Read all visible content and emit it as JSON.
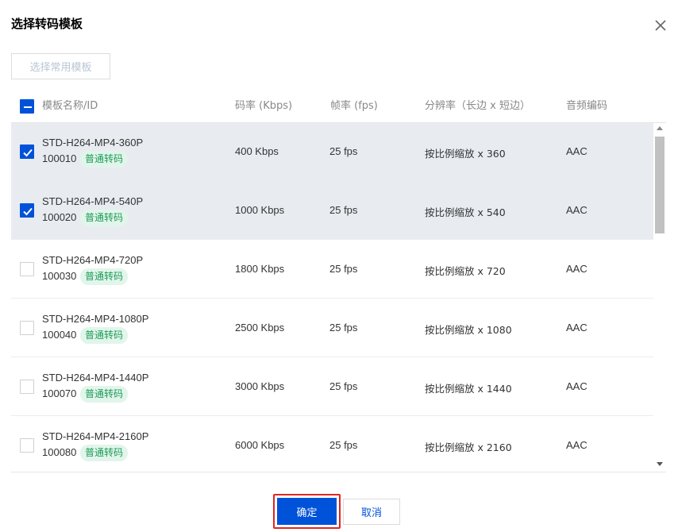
{
  "dialog": {
    "title": "选择转码模板",
    "common_templates_button": "选择常用模板",
    "ok_label": "确定",
    "cancel_label": "取消"
  },
  "table": {
    "select_all_state": "partial",
    "columns": {
      "name": "模板名称/ID",
      "bitrate": "码率 (Kbps)",
      "fps": "帧率 (fps)",
      "resolution": "分辨率（长边 x 短边）",
      "audio": "音频编码"
    },
    "rows": [
      {
        "name": "STD-H264-MP4-360P",
        "id": "100010",
        "tag": "普通转码",
        "bitrate": "400 Kbps",
        "fps": "25 fps",
        "resolution": "按比例缩放 x 360",
        "audio": "AAC",
        "checked": true
      },
      {
        "name": "STD-H264-MP4-540P",
        "id": "100020",
        "tag": "普通转码",
        "bitrate": "1000 Kbps",
        "fps": "25 fps",
        "resolution": "按比例缩放 x 540",
        "audio": "AAC",
        "checked": true
      },
      {
        "name": "STD-H264-MP4-720P",
        "id": "100030",
        "tag": "普通转码",
        "bitrate": "1800 Kbps",
        "fps": "25 fps",
        "resolution": "按比例缩放 x 720",
        "audio": "AAC",
        "checked": false
      },
      {
        "name": "STD-H264-MP4-1080P",
        "id": "100040",
        "tag": "普通转码",
        "bitrate": "2500 Kbps",
        "fps": "25 fps",
        "resolution": "按比例缩放 x 1080",
        "audio": "AAC",
        "checked": false
      },
      {
        "name": "STD-H264-MP4-1440P",
        "id": "100070",
        "tag": "普通转码",
        "bitrate": "3000 Kbps",
        "fps": "25 fps",
        "resolution": "按比例缩放 x 1440",
        "audio": "AAC",
        "checked": false
      },
      {
        "name": "STD-H264-MP4-2160P",
        "id": "100080",
        "tag": "普通转码",
        "bitrate": "6000 Kbps",
        "fps": "25 fps",
        "resolution": "按比例缩放 x 2160",
        "audio": "AAC",
        "checked": false
      }
    ]
  },
  "colors": {
    "primary": "#0052d9",
    "selected_row": "#e8ecf1",
    "tag_bg": "#e2f5eb",
    "tag_text": "#1c9b58",
    "highlight_border": "#e0261f"
  },
  "icons": {
    "close": "close-icon",
    "check": "check-icon",
    "indeterminate": "minus-icon",
    "scroll_up": "scroll-up-arrow-icon",
    "scroll_down": "scroll-down-arrow-icon"
  }
}
